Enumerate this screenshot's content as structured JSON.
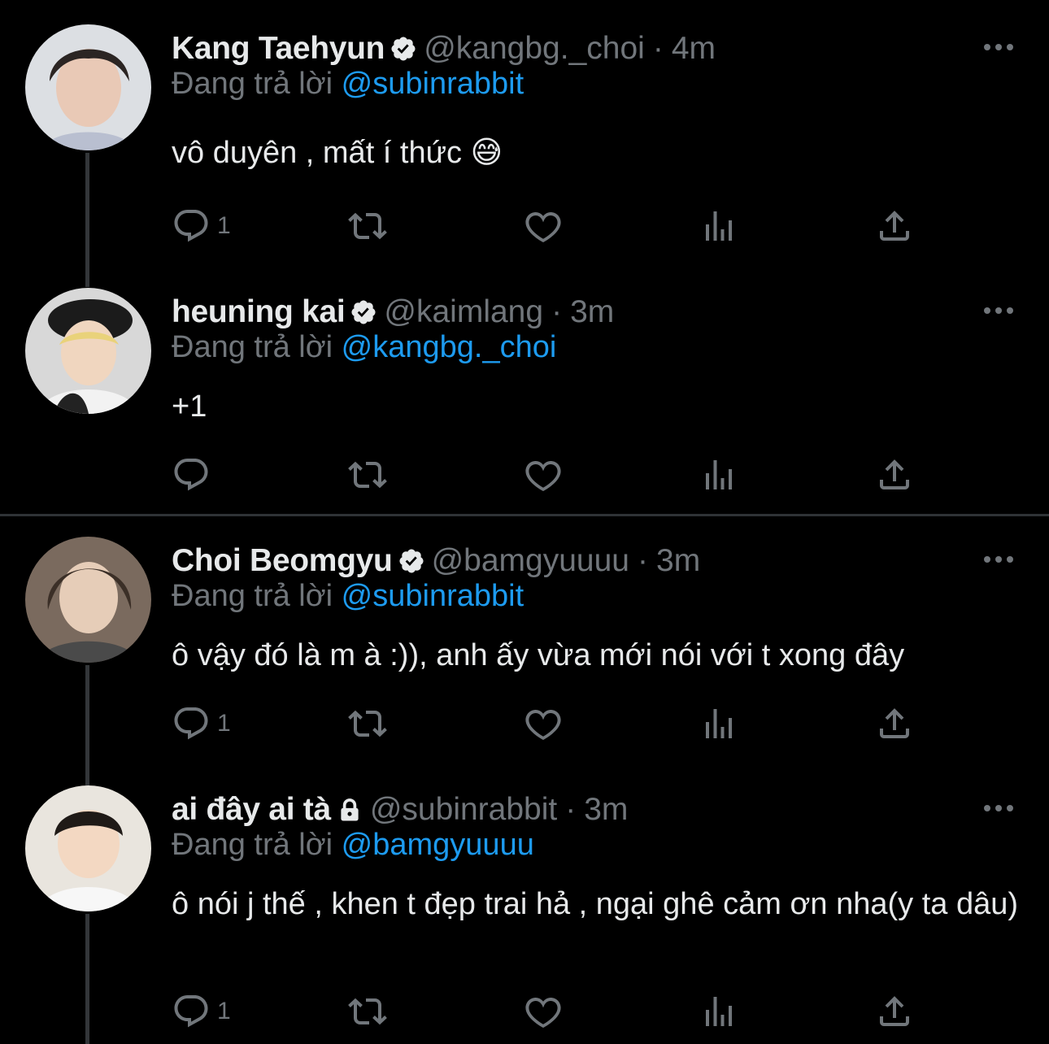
{
  "reply_prefix": "Đang trả lời",
  "colors": {
    "background": "#000000",
    "text": "#e7e9ea",
    "muted": "#71767b",
    "accent": "#1d9bf0",
    "divider": "#2f3336"
  },
  "icons": {
    "verified": "verified-badge-icon",
    "locked": "lock-icon",
    "more": "more-dots-icon",
    "reply": "reply-icon",
    "retweet": "retweet-icon",
    "like": "like-icon",
    "views": "views-icon",
    "share": "share-icon"
  },
  "tweets": [
    {
      "name": "Kang Taehyun",
      "handle": "@kangbg._choi",
      "separator": "·",
      "time": "4m",
      "reply_to": "@subinrabbit",
      "text": "vô duyên , mất í thức 😅",
      "reply_count": "1",
      "badge": "verified"
    },
    {
      "name": "heuning kai",
      "handle": "@kaimlang",
      "separator": "·",
      "time": "3m",
      "reply_to": "@kangbg._choi",
      "text": "+1",
      "reply_count": "",
      "badge": "verified"
    },
    {
      "name": "Choi Beomgyu",
      "handle": "@bamgyuuuu",
      "separator": "·",
      "time": "3m",
      "reply_to": "@subinrabbit",
      "text": "ô vậy đó là m à :)), anh ấy vừa mới nói với t xong đây",
      "reply_count": "1",
      "badge": "verified"
    },
    {
      "name": "ai đây ai tà",
      "handle": "@subinrabbit",
      "separator": "·",
      "time": "3m",
      "reply_to": "@bamgyuuuu",
      "text": "ô nói j thế , khen t đẹp trai hả , ngại ghê cảm ơn nha(y ta dâu)",
      "reply_count": "1",
      "badge": "locked"
    }
  ]
}
